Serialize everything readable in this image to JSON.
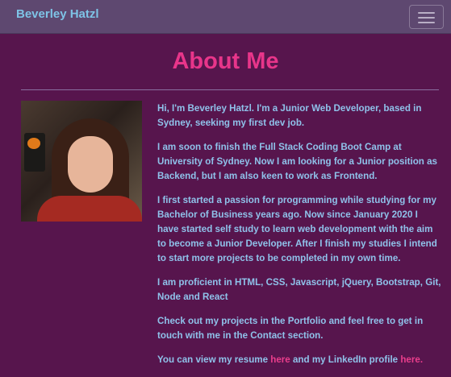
{
  "navbar": {
    "brand": "Beverley Hatzl",
    "toggle_icon": "hamburger-icon"
  },
  "colors": {
    "background": "#57154d",
    "navbar": "#5e4870",
    "brand": "#7ec3e6",
    "title": "#e8358a",
    "text": "#8fc2ea",
    "link": "#ea3d8c"
  },
  "main": {
    "title": "About Me",
    "photo_icon": "profile-photo",
    "paragraphs": [
      "Hi, I'm Beverley Hatzl. I'm a Junior Web Developer, based in Sydney, seeking my first dev job.",
      "I am soon to finish the Full Stack Coding Boot Camp at University of Sydney. Now I am looking for a Junior position as Backend, but I am also keen to work as Frontend.",
      "I first started a passion for programming while studying for my Bachelor of Business years ago. Now since January 2020 I have started self study to learn web development with the aim to become a Junior Developer. After I finish my studies I intend to start more projects to be completed in my own time.",
      "I am proficient in HTML, CSS, Javascript, jQuery, Bootstrap, Git, Node and React",
      "Check out my projects in the Portfolio and feel free to get in touch with me in the Contact section."
    ],
    "resume_line": {
      "prefix": "You can view my resume ",
      "resume_link": "here",
      "middle": " and my LinkedIn profile ",
      "linkedin_link": "here."
    }
  }
}
